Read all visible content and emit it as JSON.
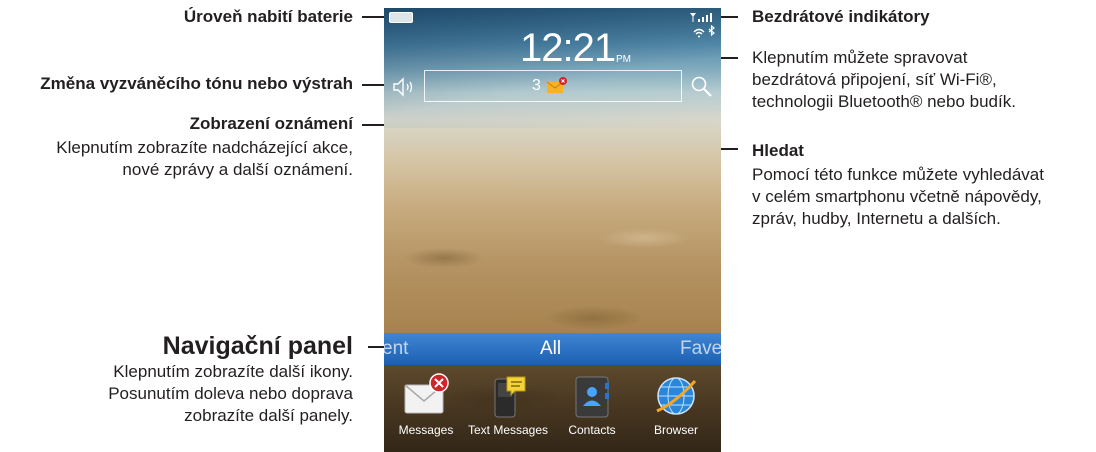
{
  "annotations": {
    "battery_level": "Úroveň nabití baterie",
    "ringtone_change": "Změna vyzváněcího tónu nebo výstrah",
    "notifications_title": "Zobrazení oznámení",
    "notifications_desc": [
      "Klepnutím zobrazíte nadcházející akce,",
      "nové zprávy a další oznámení."
    ],
    "wireless_title": "Bezdrátové indikátory",
    "wireless_desc": [
      "Klepnutím můžete spravovat",
      "bezdrátová připojení, síť Wi-Fi®,",
      "technologii Bluetooth® nebo budík."
    ],
    "search_title": "Hledat",
    "search_desc": [
      "Pomocí této funkce můžete vyhledávat",
      "v celém smartphonu včetně nápovědy,",
      "zpráv, hudby, Internetu a dalších."
    ],
    "navbar_title": "Navigační panel",
    "navbar_desc": [
      "Klepnutím zobrazíte další ikony.",
      "Posunutím doleva nebo doprava",
      "zobrazíte další panely."
    ]
  },
  "phone": {
    "clock": "12:21",
    "ampm": "PM",
    "notification_count": "3",
    "nav_tabs": {
      "left": "ent",
      "center": "All",
      "right": "Fave"
    },
    "apps": [
      {
        "label": "Messages",
        "icon": "messages-envelope-icon"
      },
      {
        "label": "Text Messages",
        "icon": "text-messages-icon"
      },
      {
        "label": "Contacts",
        "icon": "contacts-icon"
      },
      {
        "label": "Browser",
        "icon": "browser-globe-icon"
      }
    ],
    "colors": {
      "navbar": "#1c5fb3",
      "badge": "#d0232a",
      "notif_envelope": "#f5b324"
    }
  }
}
